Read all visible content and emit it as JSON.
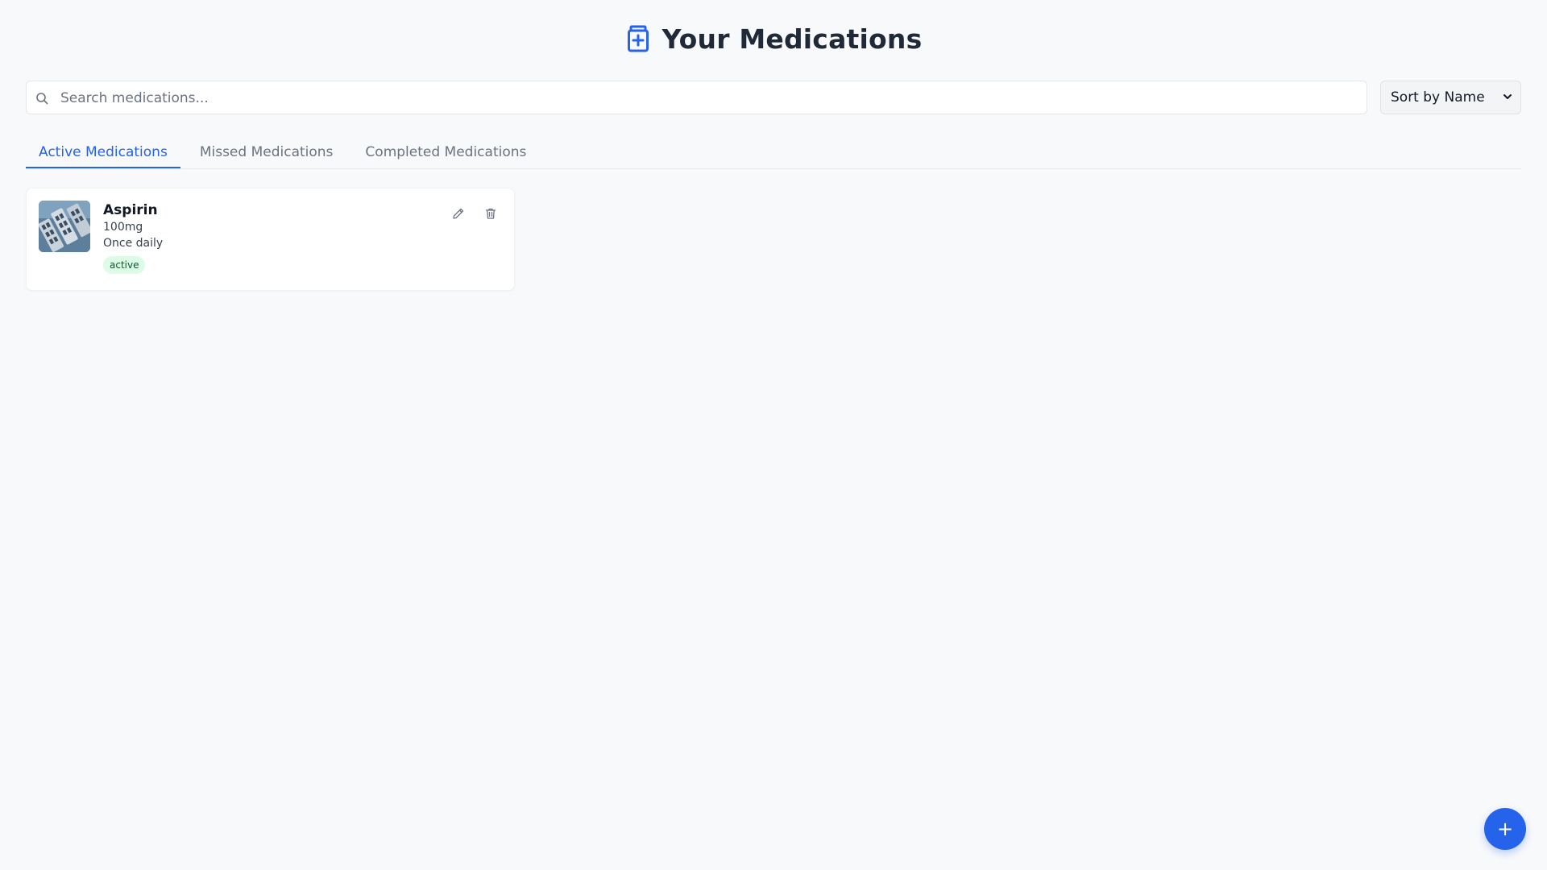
{
  "header": {
    "title": "Your Medications",
    "icon": "medicine-bottle-icon",
    "accent_color": "#2563eb"
  },
  "search": {
    "placeholder": "Search medications...",
    "value": "",
    "icon": "search-icon"
  },
  "sort": {
    "selected": "Sort by Name",
    "icon": "chevron-down-icon"
  },
  "tabs": [
    {
      "label": "Active Medications",
      "active": true
    },
    {
      "label": "Missed Medications",
      "active": false
    },
    {
      "label": "Completed Medications",
      "active": false
    }
  ],
  "medications": [
    {
      "name": "Aspirin",
      "dosage": "100mg",
      "frequency": "Once daily",
      "status": "active",
      "status_color": "#dcfce7",
      "actions": [
        "edit-icon",
        "trash-icon"
      ]
    }
  ],
  "fab": {
    "label": "+",
    "icon": "plus-icon"
  }
}
